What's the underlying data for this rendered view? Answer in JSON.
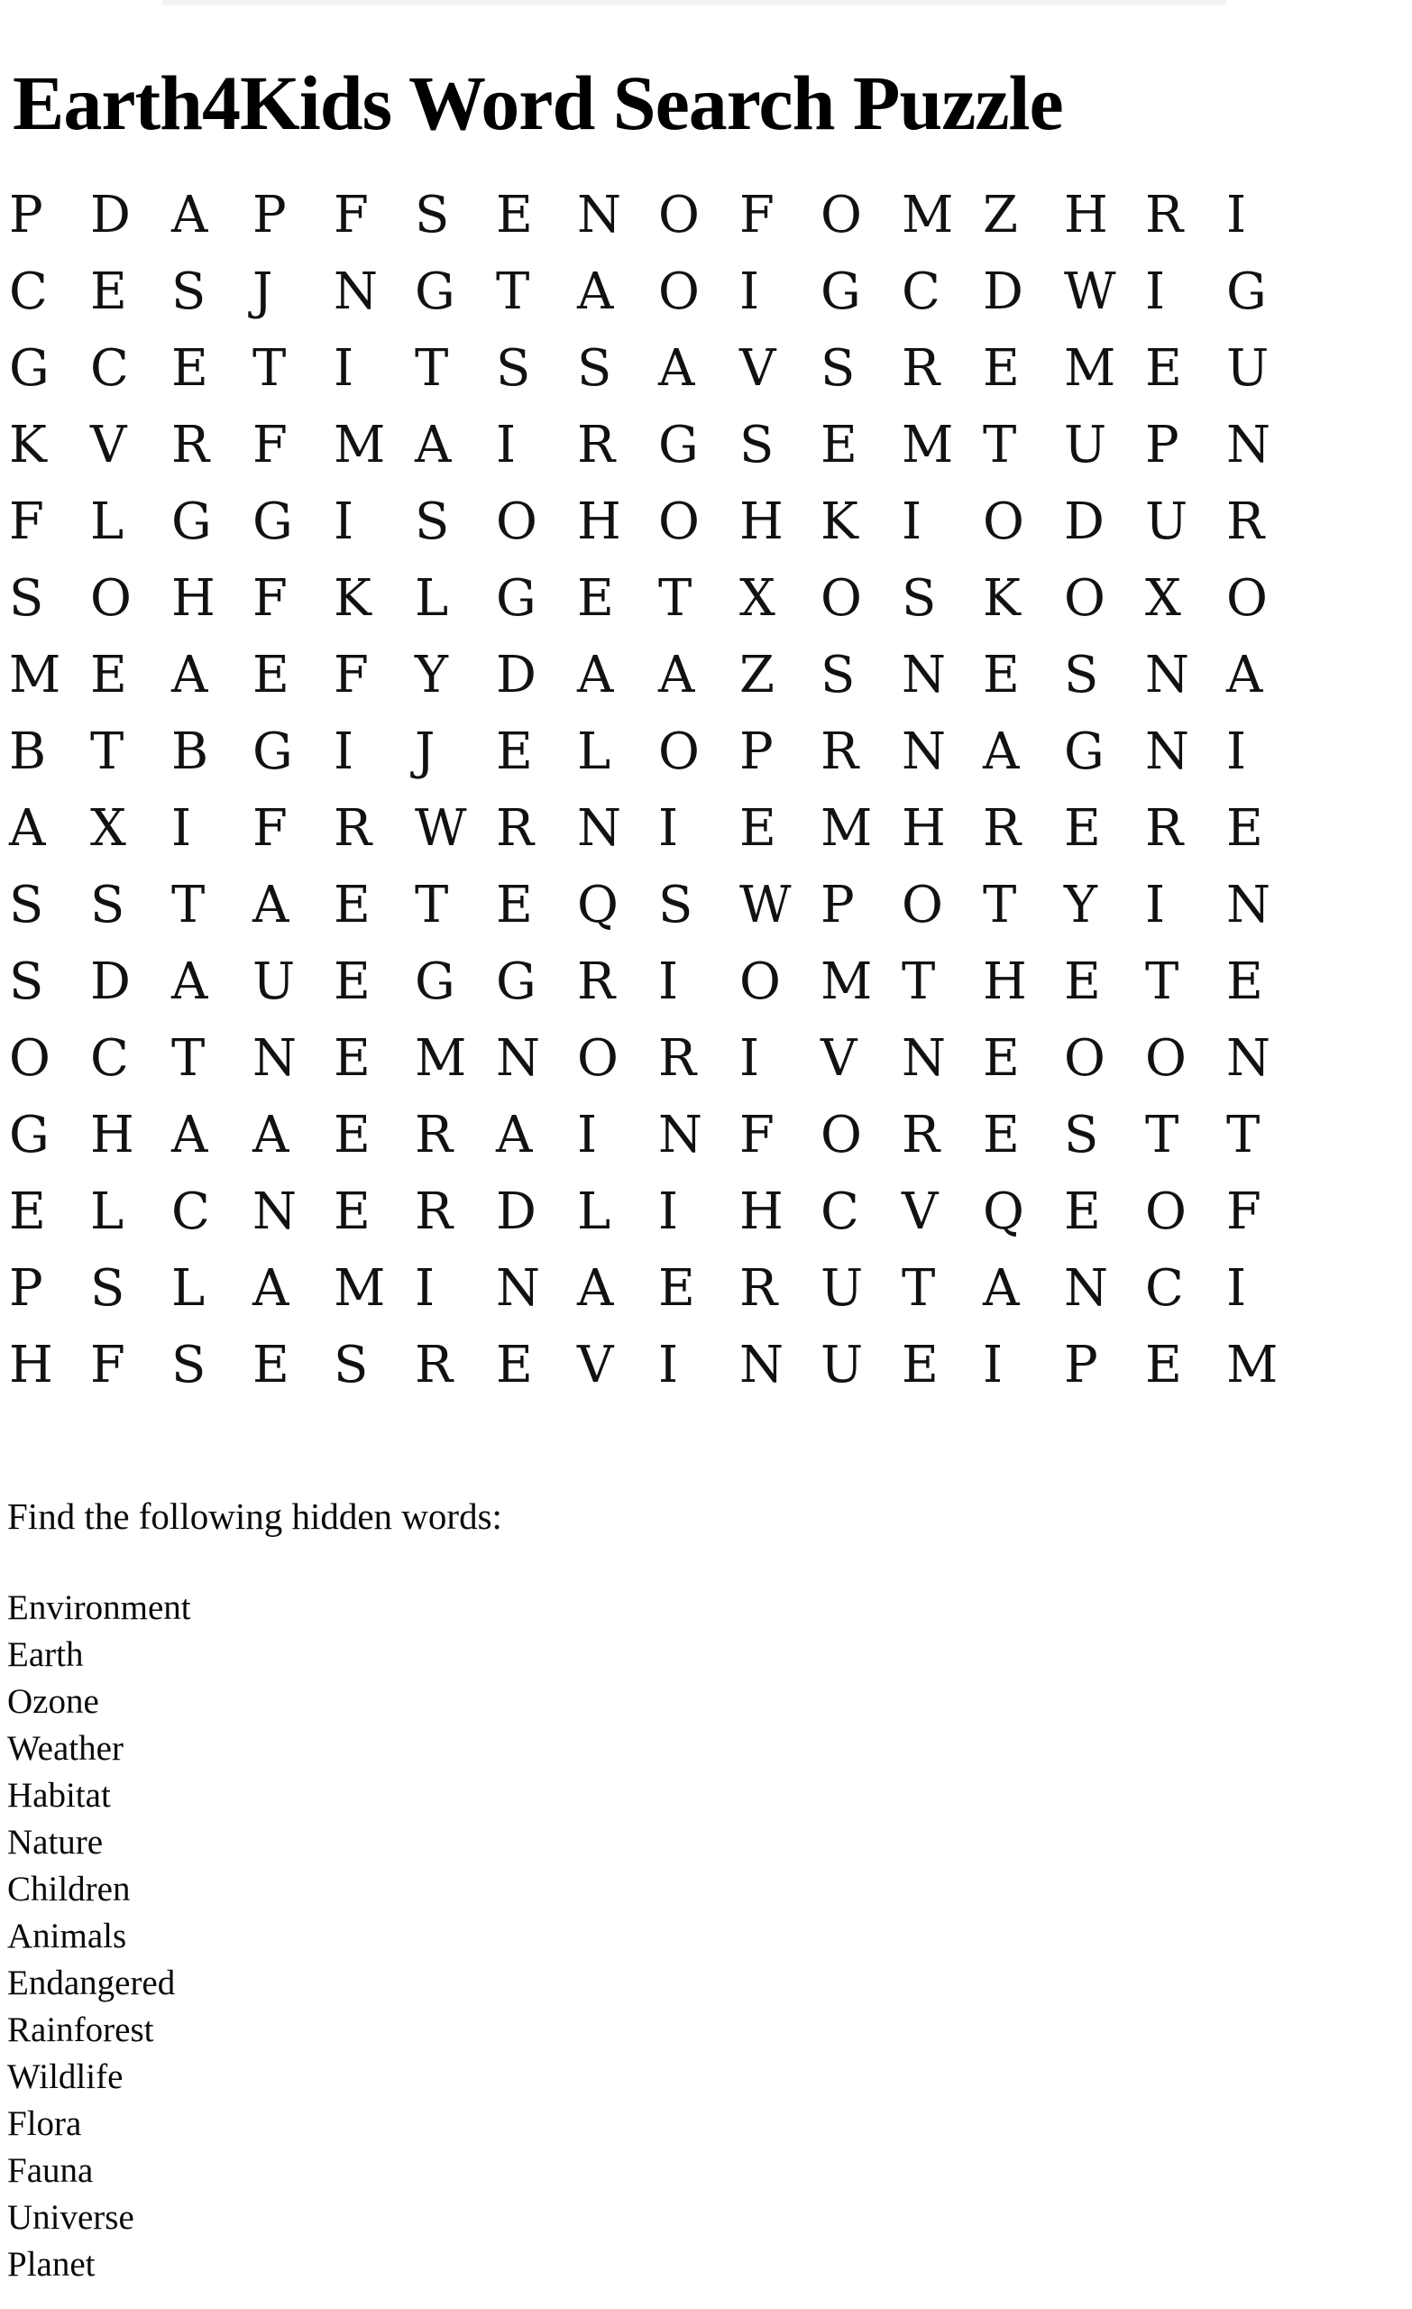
{
  "document": {
    "title": "Earth4Kids Word Search Puzzle",
    "background_color": "#ffffff",
    "text_color": "#0a0a0a"
  },
  "grid": {
    "rows": 16,
    "columns": 16,
    "letters": [
      [
        "P",
        "D",
        "A",
        "P",
        "F",
        "S",
        "E",
        "N",
        "O",
        "F",
        "O",
        "M",
        "Z",
        "H",
        "R",
        "I"
      ],
      [
        "C",
        "E",
        "S",
        "J",
        "N",
        "G",
        "T",
        "A",
        "O",
        "I",
        "G",
        "C",
        "D",
        "W",
        "I",
        "G"
      ],
      [
        "G",
        "C",
        "E",
        "T",
        "I",
        "T",
        "S",
        "S",
        "A",
        "V",
        "S",
        "R",
        "E",
        "M",
        "E",
        "U"
      ],
      [
        "K",
        "V",
        "R",
        "F",
        "M",
        "A",
        "I",
        "R",
        "G",
        "S",
        "E",
        "M",
        "T",
        "U",
        "P",
        "N"
      ],
      [
        "F",
        "L",
        "G",
        "G",
        "I",
        "S",
        "O",
        "H",
        "O",
        "H",
        "K",
        "I",
        "O",
        "D",
        "U",
        "R"
      ],
      [
        "S",
        "O",
        "H",
        "F",
        "K",
        "L",
        "G",
        "E",
        "T",
        "X",
        "O",
        "S",
        "K",
        "O",
        "X",
        "O"
      ],
      [
        "M",
        "E",
        "A",
        "E",
        "F",
        "Y",
        "D",
        "A",
        "A",
        "Z",
        "S",
        "N",
        "E",
        "S",
        "N",
        "A"
      ],
      [
        "B",
        "T",
        "B",
        "G",
        "I",
        "J",
        "E",
        "L",
        "O",
        "P",
        "R",
        "N",
        "A",
        "G",
        "N",
        "I"
      ],
      [
        "A",
        "X",
        "I",
        "F",
        "R",
        "W",
        "R",
        "N",
        "I",
        "E",
        "M",
        "H",
        "R",
        "E",
        "R",
        "E"
      ],
      [
        "S",
        "S",
        "T",
        "A",
        "E",
        "T",
        "E",
        "Q",
        "S",
        "W",
        "P",
        "O",
        "T",
        "Y",
        "I",
        "N"
      ],
      [
        "S",
        "D",
        "A",
        "U",
        "E",
        "G",
        "G",
        "R",
        "I",
        "O",
        "M",
        "T",
        "H",
        "E",
        "T",
        "E"
      ],
      [
        "O",
        "C",
        "T",
        "N",
        "E",
        "M",
        "N",
        "O",
        "R",
        "I",
        "V",
        "N",
        "E",
        "O",
        "O",
        "N"
      ],
      [
        "G",
        "H",
        "A",
        "A",
        "E",
        "R",
        "A",
        "I",
        "N",
        "F",
        "O",
        "R",
        "E",
        "S",
        "T",
        "T"
      ],
      [
        "E",
        "L",
        "C",
        "N",
        "E",
        "R",
        "D",
        "L",
        "I",
        "H",
        "C",
        "V",
        "Q",
        "E",
        "O",
        "F"
      ],
      [
        "P",
        "S",
        "L",
        "A",
        "M",
        "I",
        "N",
        "A",
        "E",
        "R",
        "U",
        "T",
        "A",
        "N",
        "C",
        "I"
      ],
      [
        "H",
        "F",
        "S",
        "E",
        "S",
        "R",
        "E",
        "V",
        "I",
        "N",
        "U",
        "E",
        "I",
        "P",
        "E",
        "M"
      ]
    ]
  },
  "wordlist": {
    "prompt": "Find the following hidden words:",
    "words": [
      "Environment",
      "Earth",
      "Ozone",
      "Weather",
      "Habitat",
      "Nature",
      "Children",
      "Animals",
      "Endangered",
      "Rainforest",
      "Wildlife",
      "Flora",
      "Fauna",
      "Universe",
      "Planet"
    ]
  }
}
